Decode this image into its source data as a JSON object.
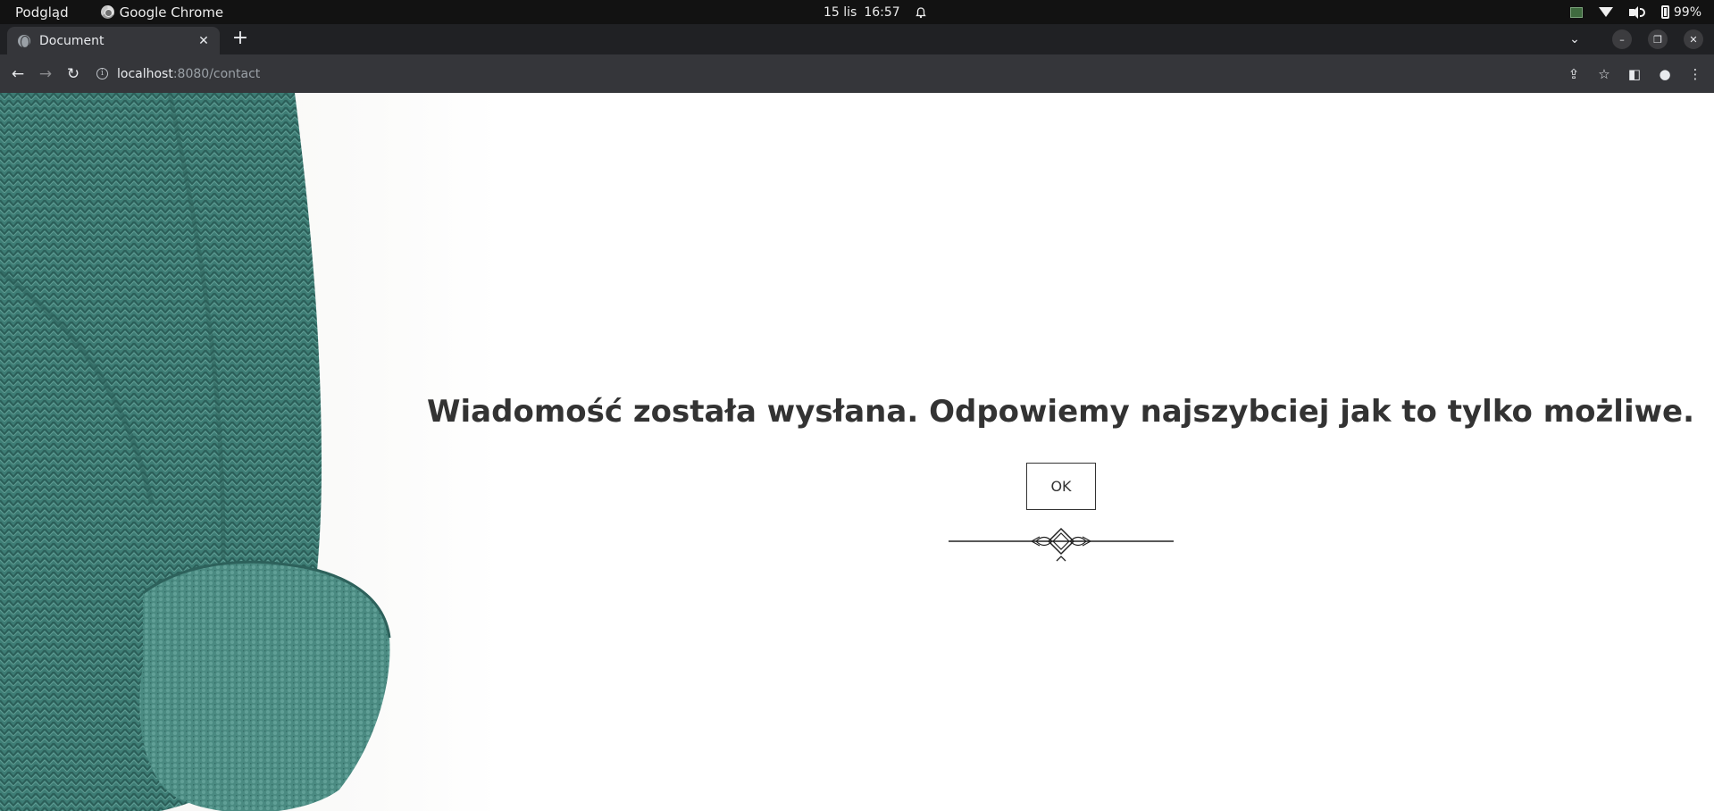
{
  "system_bar": {
    "activities": "Podgląd",
    "app_name": "Google Chrome",
    "date": "15 lis",
    "time": "16:57",
    "battery": "99%",
    "icons": [
      "alarm-icon",
      "tray-image-icon",
      "wifi-icon",
      "volume-icon",
      "battery-icon"
    ]
  },
  "browser": {
    "tab_title": "Document",
    "new_tab_label": "+",
    "address_host": "localhost",
    "address_path": ":8080/contact",
    "icons": [
      "back-icon",
      "forward-icon",
      "reload-icon",
      "site-info-icon",
      "share-icon",
      "bookmark-star-icon",
      "side-panel-icon",
      "profile-icon",
      "menu-icon",
      "tab-search-icon",
      "minimize-icon",
      "restore-icon",
      "close-icon"
    ]
  },
  "page": {
    "message": "Wiadomość została wysłana. Odpowiemy najszybciej jak to tylko możliwe.",
    "ok_label": "OK"
  },
  "colors": {
    "sweater": "#3e7e76",
    "text": "#333333",
    "chrome_dark": "#35363a"
  }
}
